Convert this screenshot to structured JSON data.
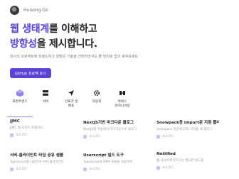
{
  "header": {
    "author": "Huisong Go"
  },
  "hero": {
    "line1_accent": "웹 생태계",
    "line1_rest": "를 이해하고",
    "line2_accent": "방향성",
    "line2_rest": "을 제시합니다."
  },
  "subtitle": "회사의 프로젝트에 트렌드하고 알맞은 기술을 선택하면서도 뿐 방치로 없이 새겨보세요",
  "github_button": "GitHub 프로젝 보기",
  "categories": [
    {
      "label": "프론트엔드",
      "icon": "front-end-icon"
    },
    {
      "label": "서버",
      "icon": "server-icon"
    },
    {
      "label": "인프라 및\n배포",
      "icon": "deploy-icon"
    },
    {
      "label": "자동화",
      "icon": "automation-icon"
    },
    {
      "label": "위넥스\n엔지니어링",
      "icon": "engineering-icon"
    }
  ],
  "cards": [
    {
      "title": "JJMC",
      "desc": "JJMC 웹 사이트 마플리의",
      "source": "소스코드"
    },
    {
      "title": "NextJS기반 마크다운 블로그",
      "desc": "NextJS를 이용해서 마크다운으로 블로그",
      "source": "소스코드"
    },
    {
      "title": "Snowpack용 import문 지원 플러그인",
      "desc": "Snowpack 엔진에 CSS 가져올 때 플러그",
      "source": "소스코드"
    },
    {
      "title": "서버-클라이언트 타입 공유 샘플",
      "desc": "TypeScript를 사용하여 서버-클라이언트",
      "source": "소스코드"
    },
    {
      "title": "Userscript 빌드 도구",
      "desc": "TypeScript와 NPM 모듈을 사용하여",
      "source": "소스코드"
    },
    {
      "title": "Netlified",
      "desc": "웹 사이트에 방치하는 필요한 빌드를",
      "desc2": "소스코드",
      "source": ""
    }
  ],
  "colors": {
    "accent": "#5b43d6"
  }
}
